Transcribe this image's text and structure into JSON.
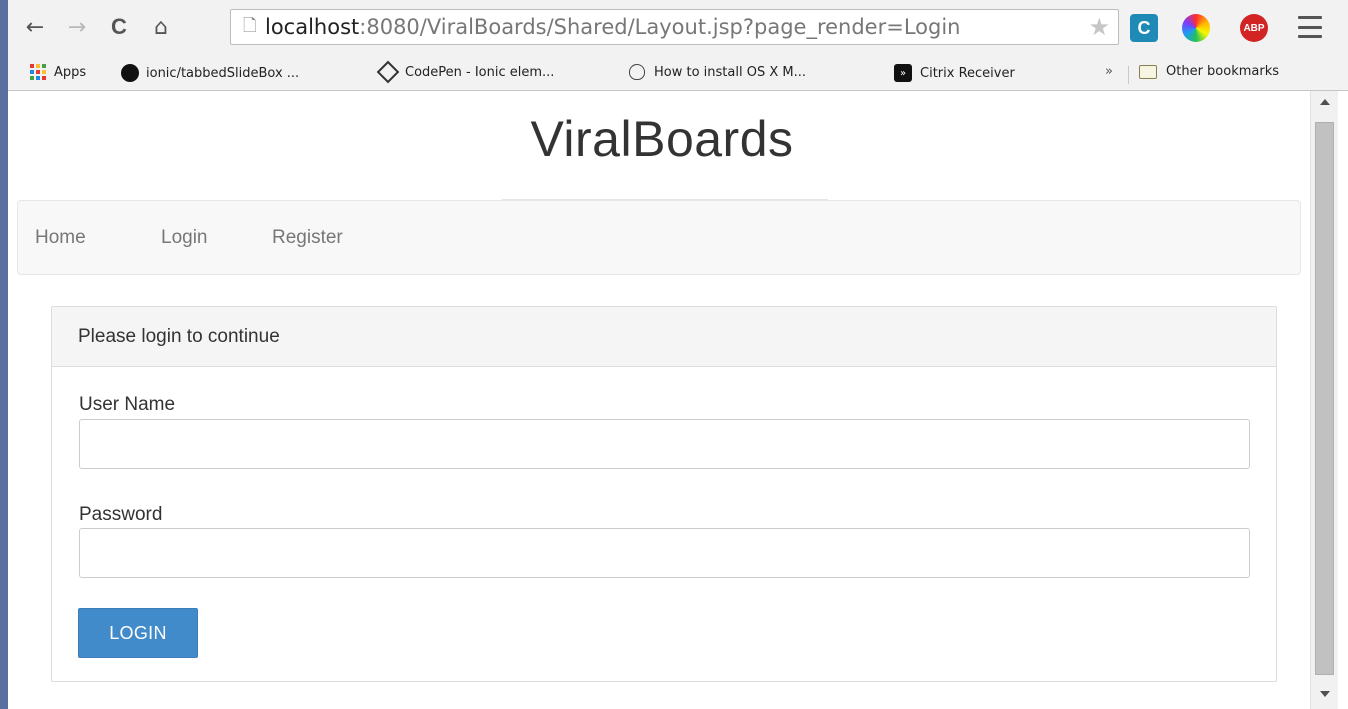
{
  "browser": {
    "back_icon": "←",
    "forward_icon": "→",
    "reload_icon": "C",
    "home_icon": "⌂",
    "url_host": "localhost",
    "url_rest": ":8080/ViralBoards/Shared/Layout.jsp?page_render=Login",
    "star_icon": "★",
    "ext_c_label": "C",
    "ext_abp_label": "ABP"
  },
  "bookmarks": {
    "apps_label": "Apps",
    "items": [
      {
        "label": "ionic/tabbedSlideBox ...",
        "icon": "github-icon"
      },
      {
        "label": "CodePen - Ionic elem...",
        "icon": "codepen-icon"
      },
      {
        "label": "How to install OS X M...",
        "icon": "apple-icon"
      },
      {
        "label": "Citrix Receiver",
        "icon": "citrix-icon"
      }
    ],
    "more_label": "»",
    "other_label": "Other bookmarks"
  },
  "app": {
    "brand": "ViralBoards",
    "nav": [
      "Home",
      "Login",
      "Register"
    ]
  },
  "login": {
    "heading": "Please login to continue",
    "username_label": "User Name",
    "username_value": "",
    "password_label": "Password",
    "password_value": "",
    "button_label": "LOGIN"
  },
  "colors": {
    "primary_button": "#428bca",
    "navbar_bg": "#f8f8f8",
    "panel_heading_bg": "#f5f5f5"
  }
}
